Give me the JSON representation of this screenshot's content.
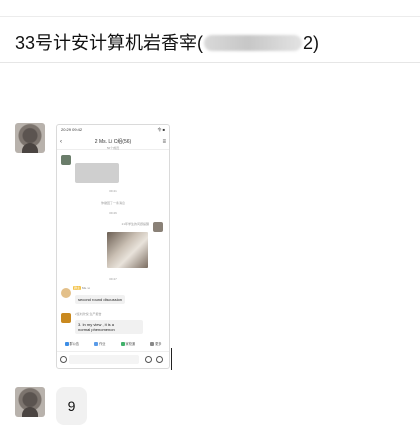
{
  "chat": {
    "title_prefix": "33号计安计算机岩香宰(",
    "title_suffix": "2)"
  },
  "screenshot": {
    "status_time": "20:29 09:42",
    "status_right": "令 ■",
    "chat_title": "2  Ms. Li C组(56)",
    "chat_subtitle": "56个成员",
    "system_time_1": "09:41",
    "system_text": "你撤回了一条消息",
    "system_time_2": "09:46",
    "sender_label": "21年学生的问题提醒",
    "system_time_3": "09:47",
    "tag_label": "群主",
    "tag_sender": "Ms. Li",
    "bubble_1": "second round discussion",
    "sender_2": "2班刘欣悦 生产报告",
    "bubble_2_line1": "3. In my view , it is a",
    "bubble_2_line2": "normal phenomenon",
    "tabs": [
      "群公告",
      "作业",
      "家校通",
      "更多"
    ]
  },
  "message": {
    "text": "9"
  },
  "colors": {
    "divider": "#e6e6e6",
    "bubble": "#f1f1f1",
    "tag": "#f3c34a",
    "tab_blue": "#3d8ee6"
  },
  "icons": [
    "back-icon",
    "menu-icon",
    "voice-icon",
    "emoji-icon",
    "plus-icon"
  ]
}
